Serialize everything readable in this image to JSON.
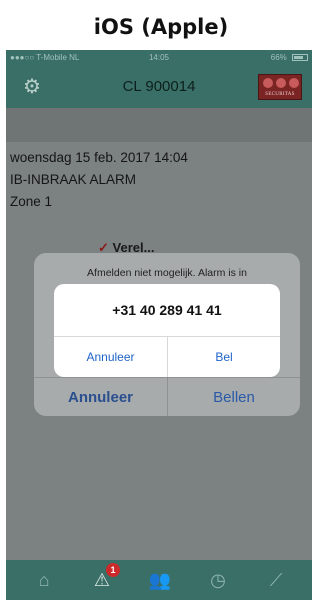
{
  "caption": "iOS (Apple)",
  "status_bar": {
    "carrier": "●●●○○ T-Mobile NL",
    "time": "14:05",
    "battery": "66%"
  },
  "nav_bar": {
    "title": "CL 900014",
    "logo_text": "SECURITAS",
    "settings_icon": "gear-icon"
  },
  "alarm": {
    "datetime": "woensdag 15 feb. 2017 14:04",
    "type": "IB-INBRAAK ALARM",
    "zone": "Zone 1",
    "peek_text": "Verel..."
  },
  "outer_dialog": {
    "message": "Afmelden niet mogelijk. Alarm is in",
    "cancel_label": "Annuleer",
    "call_label": "Bellen"
  },
  "call_sheet": {
    "phone_number": "+31 40 289 41 41",
    "cancel_label": "Annuleer",
    "call_label": "Bel"
  },
  "tab_bar": {
    "tabs": [
      {
        "icon": "home-icon",
        "glyph": "⌂"
      },
      {
        "icon": "alarm-icon",
        "glyph": "⚠",
        "badge": "1"
      },
      {
        "icon": "users-icon",
        "glyph": "👥"
      },
      {
        "icon": "history-icon",
        "glyph": "◷"
      },
      {
        "icon": "tools-icon",
        "glyph": "⟋"
      }
    ]
  },
  "colors": {
    "brand_green": "#3a6f67",
    "logo_red": "#7b2424",
    "badge_red": "#cc2a2a",
    "ios_blue": "#1e63c9"
  }
}
